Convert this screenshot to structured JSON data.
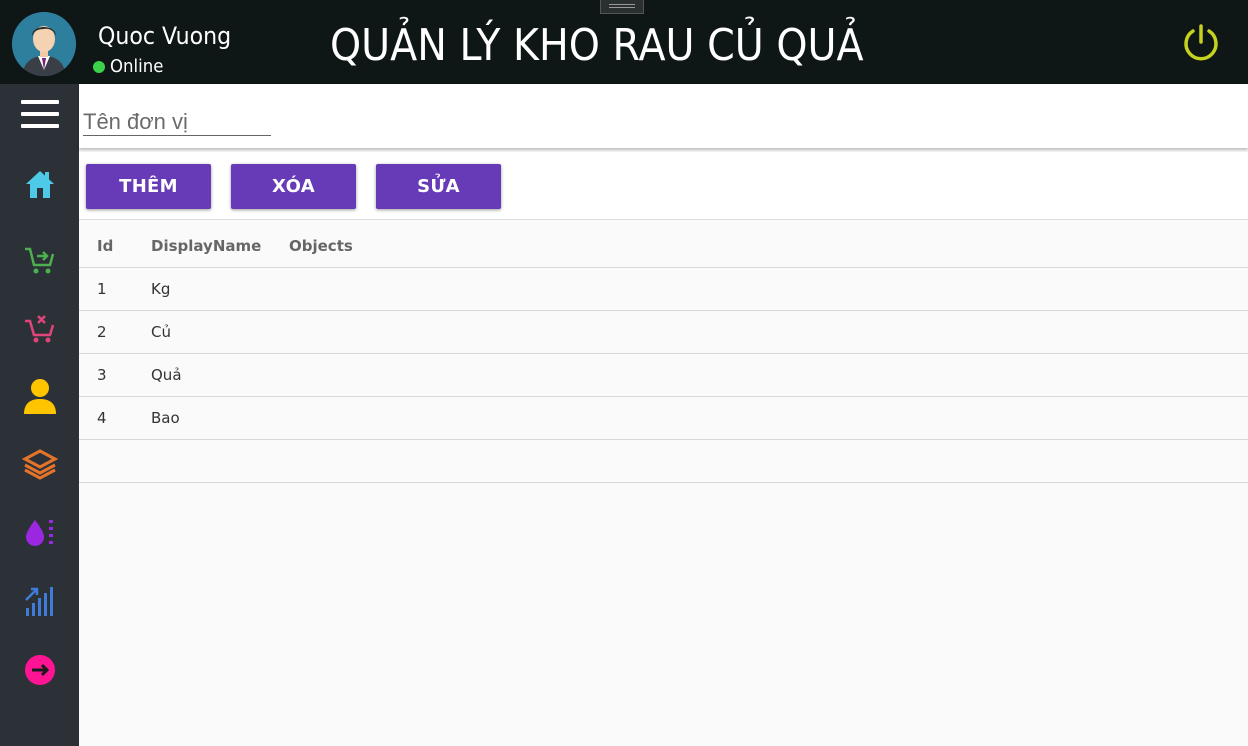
{
  "user": {
    "name": "Quoc Vuong",
    "status": "Online"
  },
  "header": {
    "title": "QUẢN LÝ KHO RAU CỦ QUẢ"
  },
  "sidebar": {
    "items": [
      {
        "icon": "home-icon",
        "color": "#4ec9e8"
      },
      {
        "icon": "cart-in-icon",
        "color": "#4caf50"
      },
      {
        "icon": "cart-out-icon",
        "color": "#e0457a"
      },
      {
        "icon": "user-icon",
        "color": "#ffc400"
      },
      {
        "icon": "layers-icon",
        "color": "#e5742a"
      },
      {
        "icon": "water-drop-icon",
        "color": "#9c27e0"
      },
      {
        "icon": "chart-bars-icon",
        "color": "#3f7bd9"
      },
      {
        "icon": "exit-arrow-icon",
        "color": "#ff1493"
      }
    ]
  },
  "form": {
    "unit_placeholder": "Tên đơn vị",
    "unit_value": ""
  },
  "toolbar": {
    "add_label": "THÊM",
    "delete_label": "XÓA",
    "edit_label": "SỬA"
  },
  "table": {
    "columns": [
      "Id",
      "DisplayName",
      "Objects"
    ],
    "rows": [
      {
        "id": "1",
        "name": "Kg",
        "objects": ""
      },
      {
        "id": "2",
        "name": "Củ",
        "objects": ""
      },
      {
        "id": "3",
        "name": "Quả",
        "objects": ""
      },
      {
        "id": "4",
        "name": "Bao",
        "objects": ""
      }
    ]
  },
  "colors": {
    "accent": "#673ab7",
    "topbar": "#0e1716",
    "sidebar": "#2c3137",
    "power": "#c6d21e"
  }
}
